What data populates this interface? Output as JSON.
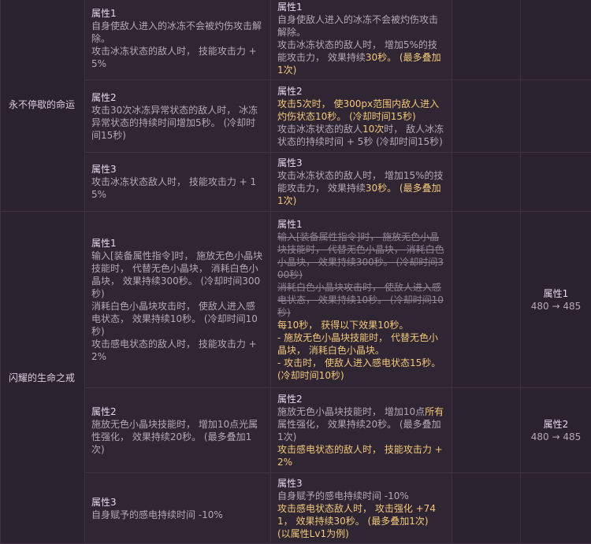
{
  "items": [
    {
      "name": "永不停歇的命运",
      "rows": [
        {
          "old": [
            "属性1",
            "自身使敌人进入的冰冻不会被灼伤攻击解除。",
            "攻击冰冻状态的敌人时， 技能攻击力 + 5%"
          ],
          "new_title": "属性1",
          "new_lines": [
            "自身使敌人进入的冰冻不会被灼伤攻击解除。",
            "攻击冰冻状态的敌人时， 增加5%的技能攻击力， 效果持续",
            "30秒",
            "。 (最多叠加1次)"
          ]
        },
        {
          "old": [
            "属性2",
            "攻击30次冰冻异常状态的敌人时， 冰冻异常状态的持续时间增加5秒。 (冷却时间15秒)"
          ],
          "new_title": "属性2",
          "new_lines": [
            "攻击5次时， 使300px范围内敌人进入灼伤状态10秒。 (冷却时间15秒)",
            "攻击冰冻状态的敌人",
            "10次",
            "时， 敌人冰冻状态的持续时间 + 5秒 (冷却时间15秒)"
          ]
        },
        {
          "old": [
            "属性3",
            "攻击冰冻状态敌人时， 技能攻击力 + 15%"
          ],
          "new_title": "属性3",
          "new_lines": [
            "攻击冰冻状态的敌人时， 增加15%的技能攻击力， 效果持续",
            "30秒",
            "。 (最多叠加1次)"
          ]
        }
      ]
    },
    {
      "name": "闪耀的生命之戒",
      "rows": [
        {
          "old": [
            "属性1",
            "输入[装备属性指令]时， 施放无色小晶块技能时， 代替无色小晶块， 消耗白色小晶块， 效果持续300秒。 (冷却时间300秒)",
            "消耗白色小晶块攻击时， 使敌人进入感电状态， 效果持续10秒。 (冷却时间10秒)",
            "攻击感电状态的敌人时， 技能攻击力 + 2%"
          ],
          "new_title": "属性1",
          "strike_lines": [
            "输入[装备属性指令]时， 施放无色小晶块技能时， 代替无色小晶块， 消耗白色小晶块， 效果持续300秒。 (冷却时间300秒)",
            "消耗白色小晶块攻击时， 使敌人进入感电状态， 效果持续10秒。 (冷却时间10秒)"
          ],
          "new_lines": [
            "每10秒， 获得以下效果10秒。",
            "- 施放无色小晶块技能时， 代替无色小晶块， 消耗白色小晶块。",
            "- 攻击时， 使敌人进入感电状态15秒。 (冷却时间10秒)"
          ],
          "extra_title": "属性1",
          "extra_value": "480 → 485"
        },
        {
          "old": [
            "属性2",
            "施放无色小晶块技能时， 增加10点光属性强化， 效果持续20秒。 (最多叠加1次)"
          ],
          "new_title": "属性2",
          "new_lines": [
            "施放无色小晶块技能时， 增加10点",
            "所有",
            "属性强化， 效果持续20秒。 (最多叠加1次)",
            "攻击感电状态的敌人时， 技能攻击力 + 2%"
          ],
          "extra_title": "属性2",
          "extra_value": "480 → 485"
        },
        {
          "old": [
            "属性3",
            "自身赋予的感电持续时间 -10%"
          ],
          "new_title": "属性3",
          "new_lines": [
            "自身赋予的感电持续时间 -10%",
            "攻击感电状态敌人时， 攻击强化 +741， 效果持续30秒。 (最多叠加1次)",
            "(以属性Lv1为例)"
          ]
        }
      ]
    }
  ]
}
